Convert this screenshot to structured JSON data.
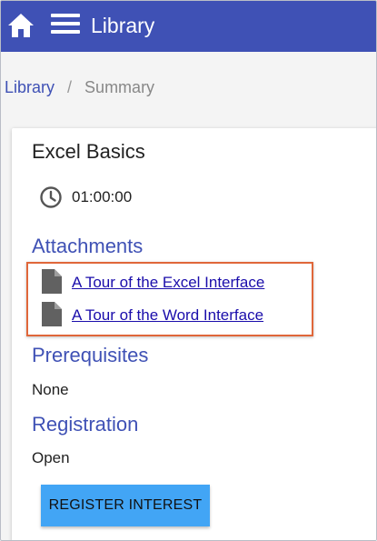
{
  "header": {
    "title": "Library",
    "home_icon": "home-icon",
    "menu_icon": "hamburger-menu-icon",
    "bg_color": "#3f51b5"
  },
  "breadcrumb": {
    "items": [
      {
        "label": "Library"
      },
      {
        "label": "Summary"
      }
    ],
    "separator": "/"
  },
  "course": {
    "title": "Excel Basics",
    "duration": "01:00:00",
    "duration_icon": "clock-icon"
  },
  "sections": {
    "attachments": {
      "heading": "Attachments",
      "items": [
        {
          "label": "A Tour of the Excel Interface",
          "icon": "file-icon"
        },
        {
          "label": "A Tour of the Word Interface",
          "icon": "file-icon"
        }
      ]
    },
    "prerequisites": {
      "heading": "Prerequisites",
      "value": "None"
    },
    "registration": {
      "heading": "Registration",
      "value": "Open"
    }
  },
  "actions": {
    "register_label": "REGISTER INTEREST",
    "register_color": "#42a5f5"
  },
  "colors": {
    "accent": "#3f51b5",
    "link": "#1a0dab",
    "highlight_border": "#e0673a"
  }
}
